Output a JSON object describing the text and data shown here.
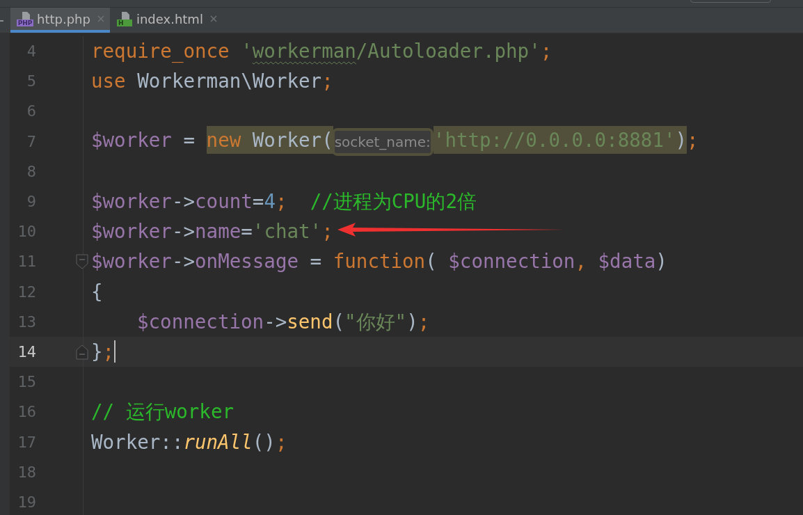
{
  "tabs": [
    {
      "label": "http.php",
      "kind": "php",
      "icon_text": "PHP",
      "selected": true
    },
    {
      "label": "index.html",
      "kind": "html",
      "icon_text": "H",
      "selected": false
    }
  ],
  "editor": {
    "lines": [
      {
        "number": "4",
        "current": false,
        "tokens": [
          {
            "kind": "keyword",
            "text": "require_once "
          },
          {
            "kind": "string",
            "text": "'"
          },
          {
            "kind": "string",
            "text": "workerman",
            "typo": true
          },
          {
            "kind": "string",
            "text": "/Autoloader.php'"
          },
          {
            "kind": "keyword",
            "text": ";"
          }
        ]
      },
      {
        "number": "5",
        "current": false,
        "tokens": [
          {
            "kind": "keyword",
            "text": "use "
          },
          {
            "kind": "plain",
            "text": "Workerman\\Worker"
          },
          {
            "kind": "keyword",
            "text": ";"
          }
        ]
      },
      {
        "number": "6",
        "current": false
      },
      {
        "number": "7",
        "current": false,
        "tokens": [
          {
            "kind": "variable",
            "text": "$worker"
          },
          {
            "kind": "plain",
            "text": " = "
          },
          {
            "kind": "keyword",
            "text": "new",
            "highlighted": true
          },
          {
            "kind": "plain",
            "text": " Worker(",
            "highlighted": true
          },
          {
            "kind": "hint",
            "text": "socket_name:",
            "highlighted": true
          },
          {
            "kind": "string",
            "text": "'http://0.0.0.0:8881'",
            "highlighted": true
          },
          {
            "kind": "plain",
            "text": ")",
            "highlighted": true
          },
          {
            "kind": "keyword",
            "text": ";"
          }
        ]
      },
      {
        "number": "8",
        "current": false
      },
      {
        "number": "9",
        "current": false,
        "tokens": [
          {
            "kind": "variable",
            "text": "$worker"
          },
          {
            "kind": "plain",
            "text": "->"
          },
          {
            "kind": "variable",
            "text": "count"
          },
          {
            "kind": "plain",
            "text": "="
          },
          {
            "kind": "number",
            "text": "4"
          },
          {
            "kind": "keyword",
            "text": ";  "
          },
          {
            "kind": "comment",
            "text": "//进程为CPU的2倍"
          }
        ]
      },
      {
        "number": "10",
        "current": false,
        "tokens": [
          {
            "kind": "variable",
            "text": "$worker"
          },
          {
            "kind": "plain",
            "text": "->"
          },
          {
            "kind": "variable",
            "text": "name"
          },
          {
            "kind": "plain",
            "text": "="
          },
          {
            "kind": "string",
            "text": "'chat'"
          },
          {
            "kind": "keyword",
            "text": ";"
          }
        ]
      },
      {
        "number": "11",
        "current": false,
        "fold_start": true,
        "tokens": [
          {
            "kind": "variable",
            "text": "$worker"
          },
          {
            "kind": "plain",
            "text": "->"
          },
          {
            "kind": "variable",
            "text": "onMessage"
          },
          {
            "kind": "plain",
            "text": " = "
          },
          {
            "kind": "keyword",
            "text": "function"
          },
          {
            "kind": "plain",
            "text": "( "
          },
          {
            "kind": "variable",
            "text": "$connection"
          },
          {
            "kind": "keyword",
            "text": ", "
          },
          {
            "kind": "variable",
            "text": "$data"
          },
          {
            "kind": "plain",
            "text": ")"
          }
        ]
      },
      {
        "number": "12",
        "current": false,
        "tokens": [
          {
            "kind": "plain",
            "text": "{"
          }
        ]
      },
      {
        "number": "13",
        "current": false,
        "indented": true,
        "tokens": [
          {
            "kind": "variable",
            "text": "$connection"
          },
          {
            "kind": "plain",
            "text": "->"
          },
          {
            "kind": "function",
            "text": "send"
          },
          {
            "kind": "plain",
            "text": "("
          },
          {
            "kind": "string",
            "text": "\"你好\""
          },
          {
            "kind": "plain",
            "text": ")"
          },
          {
            "kind": "keyword",
            "text": ";"
          }
        ]
      },
      {
        "number": "14",
        "current": true,
        "fold_end": true,
        "tokens": [
          {
            "kind": "plain",
            "text": "}"
          },
          {
            "kind": "keyword",
            "text": ";"
          }
        ]
      },
      {
        "number": "15",
        "current": false
      },
      {
        "number": "16",
        "current": false,
        "tokens": [
          {
            "kind": "comment",
            "text": "// 运行worker"
          }
        ]
      },
      {
        "number": "17",
        "current": false,
        "tokens": [
          {
            "kind": "plain",
            "text": "Worker::"
          },
          {
            "kind": "static_call",
            "text": "runAll"
          },
          {
            "kind": "plain",
            "text": "()"
          },
          {
            "kind": "keyword",
            "text": ";"
          }
        ]
      },
      {
        "number": "18",
        "current": false
      },
      {
        "number": "19",
        "current": false
      }
    ]
  }
}
